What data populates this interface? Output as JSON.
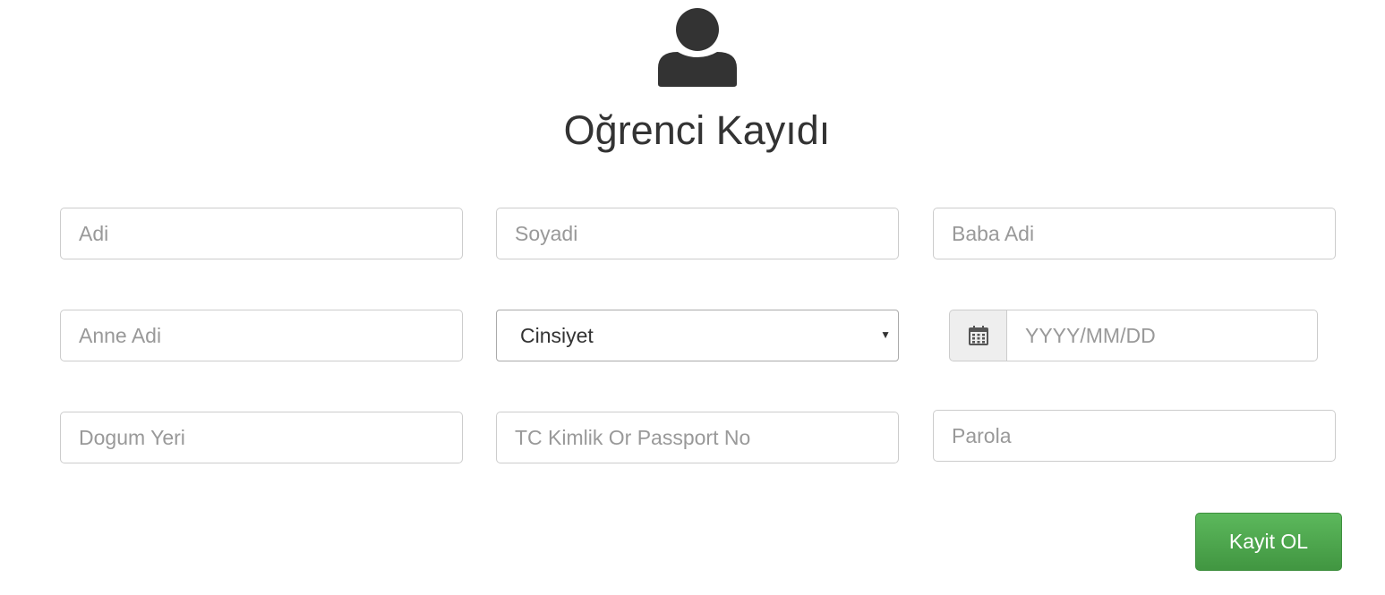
{
  "page": {
    "title": "Oğrenci Kayıdı",
    "avatar_icon": "user-icon"
  },
  "form": {
    "first_name_placeholder": "Adi",
    "last_name_placeholder": "Soyadi",
    "father_name_placeholder": "Baba Adi",
    "mother_name_placeholder": "Anne Adi",
    "gender_select": {
      "selected": "Cinsiyet",
      "icon": "caret-down-icon"
    },
    "birth_date": {
      "placeholder": "YYYY/MM/DD",
      "icon": "calendar-icon"
    },
    "birth_place_placeholder": "Dogum Yeri",
    "id_number_placeholder": "TC Kimlik Or Passport No",
    "password_placeholder": "Parola",
    "submit_label": "Kayit OL"
  },
  "colors": {
    "icon": "#333333",
    "submit_top": "#5cb85c",
    "submit_bottom": "#419641",
    "border": "#cccccc",
    "placeholder": "#999999"
  }
}
